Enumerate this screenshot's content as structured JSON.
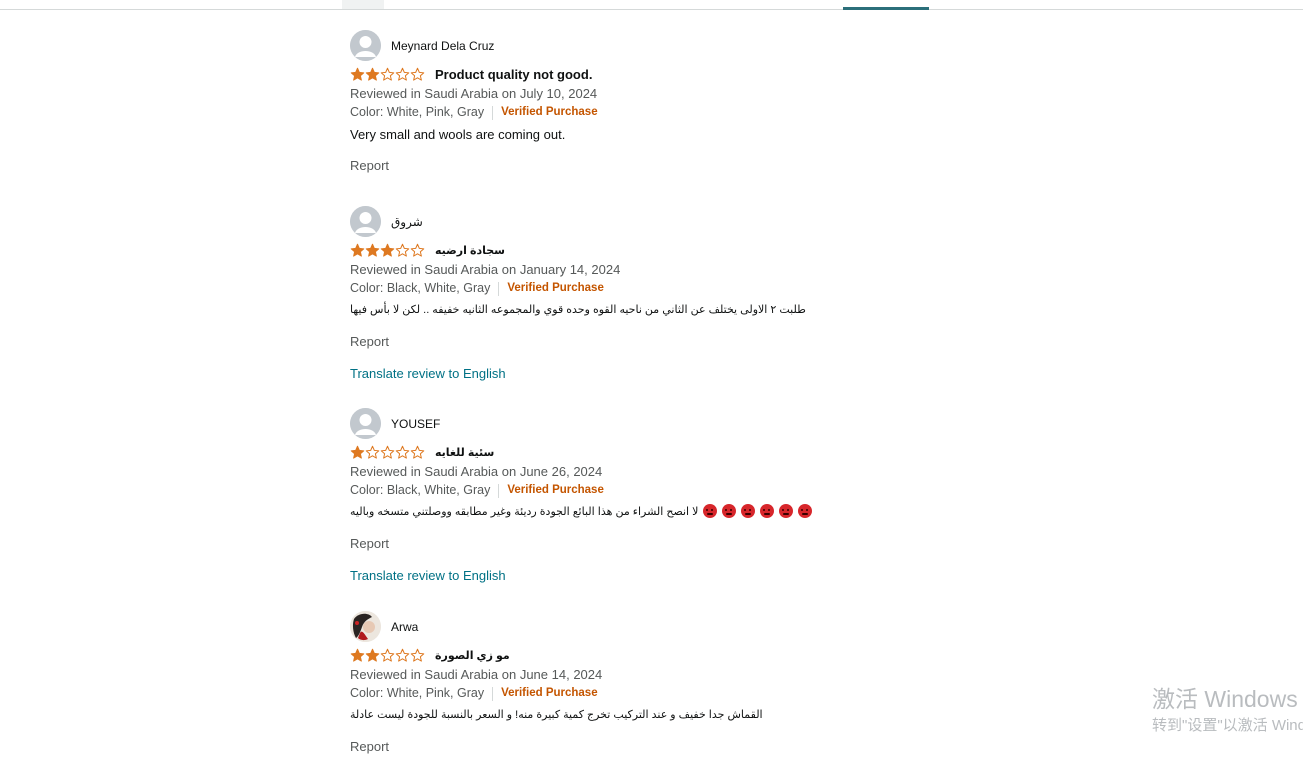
{
  "reviews": [
    {
      "name": "Meynard Dela Cruz",
      "rating": 2,
      "title": "Product quality not good.",
      "meta": "Reviewed in Saudi Arabia on July 10, 2024",
      "color": "Color: White, Pink, Gray",
      "verified": "Verified Purchase",
      "body": "Very small and wools are coming out.",
      "report": "Report"
    },
    {
      "name": "شروق",
      "rating": 3,
      "title": "سجادة ارضيه",
      "meta": "Reviewed in Saudi Arabia on January 14, 2024",
      "color": "Color: Black, White, Gray",
      "verified": "Verified Purchase",
      "body": "طلبت ٢ الاولى يختلف عن الثاني من ناحيه القوه وحده قوي والمجموعه الثانيه خفيفه .. لكن لا بأس فيها",
      "report": "Report",
      "translate": "Translate review to English"
    },
    {
      "name": "YOUSEF",
      "rating": 1,
      "title": "سئية للغايه",
      "meta": "Reviewed in Saudi Arabia on June 26, 2024",
      "color": "Color: Black, White, Gray",
      "verified": "Verified Purchase",
      "body": "لا انصح الشراء من هذا البائع الجودة رديئة وغير مطابقه ووصلتني متسخه وباليه",
      "emoji": "angry-face-icon",
      "emoji_count": 6,
      "report": "Report",
      "translate": "Translate review to English"
    },
    {
      "name": "Arwa",
      "rating": 2,
      "title": "مو زي الصورة",
      "meta": "Reviewed in Saudi Arabia on June 14, 2024",
      "color": "Color: White, Pink, Gray",
      "verified": "Verified Purchase",
      "body": "القماش جدا خفيف و عند التركيب تخرج كمية كبيرة منه! و السعر بالنسبة للجودة ليست عادلة",
      "report": "Report"
    }
  ],
  "colors": {
    "star": "#de7921",
    "verified": "#c45500",
    "link": "#007185",
    "muted": "#565959"
  },
  "watermark": {
    "line1": "激活 Windows",
    "line2": "转到\"设置\"以激活 Windows。"
  }
}
